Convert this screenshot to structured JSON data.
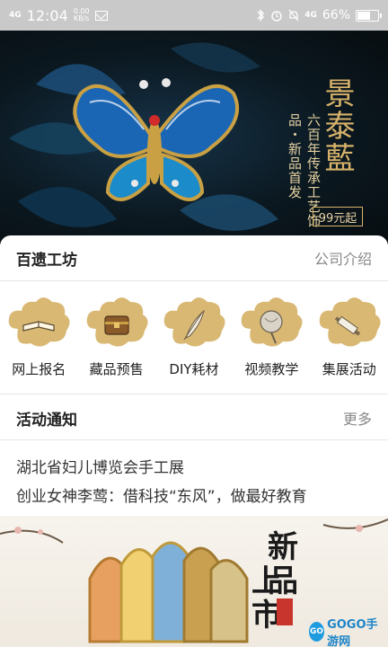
{
  "status_bar": {
    "network": "4G",
    "time": "12:04",
    "speed": "0.00",
    "speed_unit": "KB/s",
    "network2": "4G",
    "battery": "66%",
    "battery_level": 0.66
  },
  "banner": {
    "title": "景泰藍",
    "subtitle": "六百年传承工艺饰品・新品首发",
    "price": "99元起"
  },
  "workshop": {
    "title": "百遗工坊",
    "link": "公司介绍",
    "items": [
      {
        "label": "网上报名",
        "icon": "book-icon"
      },
      {
        "label": "藏品预售",
        "icon": "chest-icon"
      },
      {
        "label": "DIY耗材",
        "icon": "feather-icon"
      },
      {
        "label": "视频教学",
        "icon": "fan-icon"
      },
      {
        "label": "集展活动",
        "icon": "scroll-icon"
      }
    ]
  },
  "notice": {
    "title": "活动通知",
    "link": "更多",
    "items": [
      "湖北省妇儿博览会手工展",
      "创业女神李莺：借科技“东风”，做最好教育"
    ]
  },
  "bottom_banner": {
    "title_line1": "新品",
    "title_line2": "上市"
  },
  "watermark": {
    "badge": "GO",
    "text": "GOGO手游网"
  }
}
